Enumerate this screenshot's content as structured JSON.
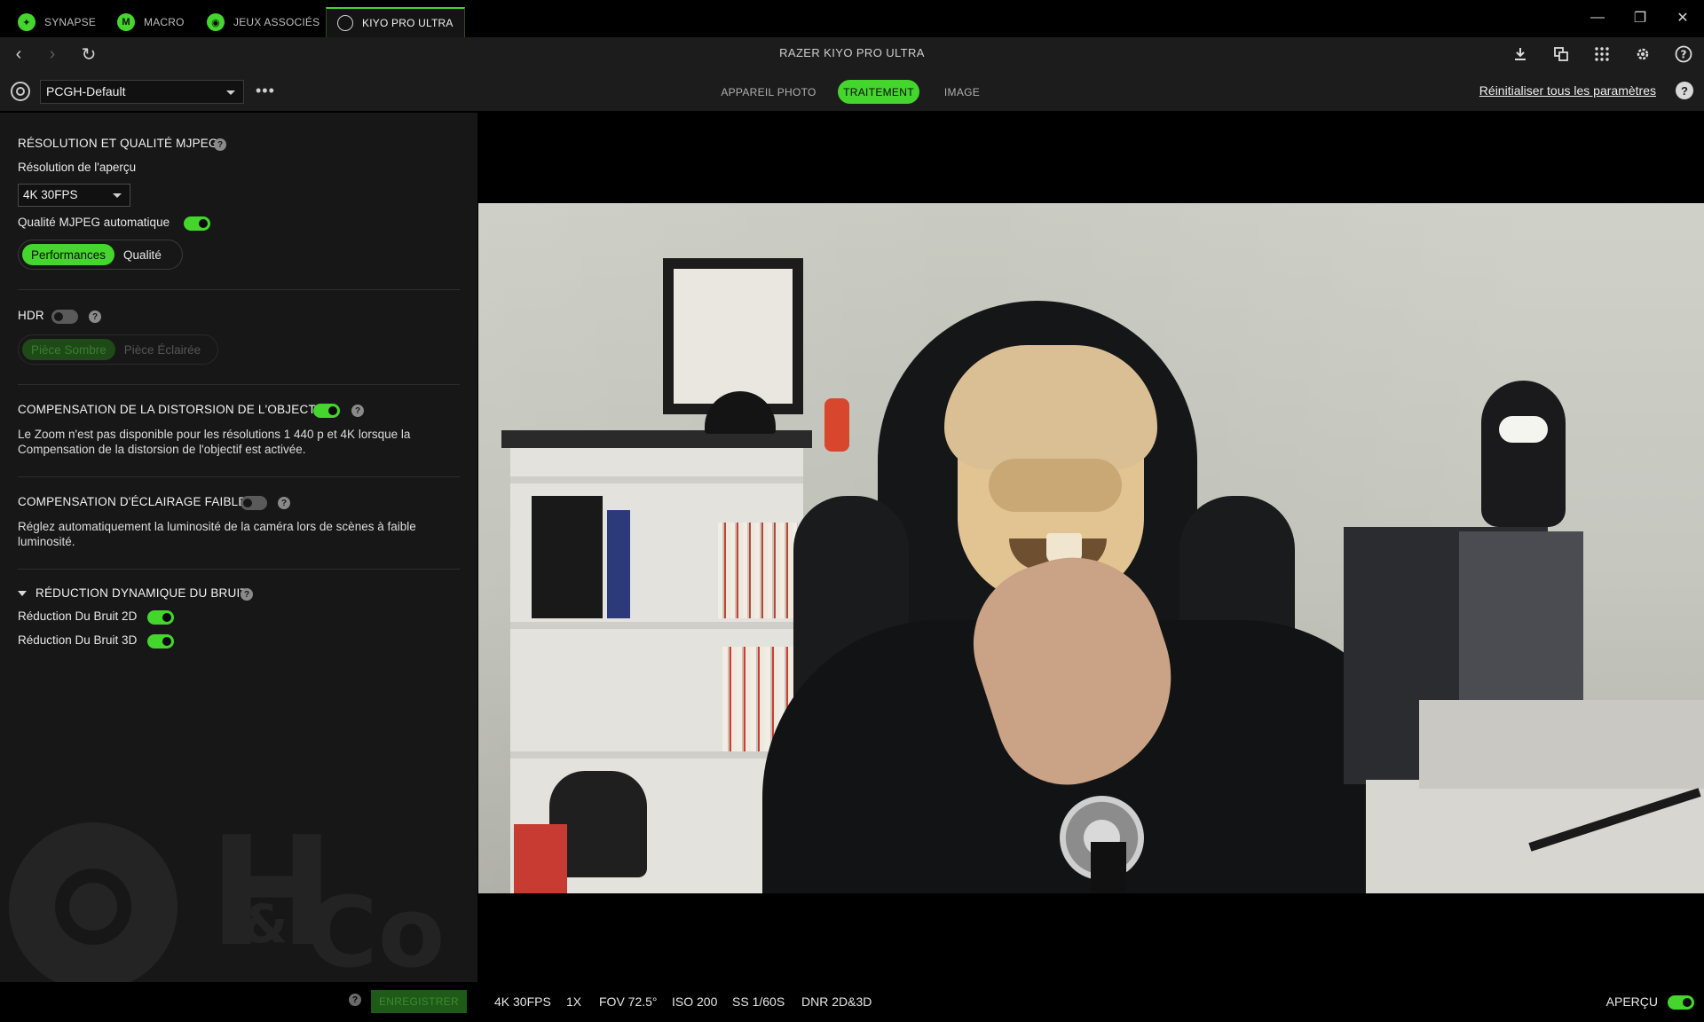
{
  "app_tabs": [
    {
      "label": "SYNAPSE",
      "icon": "razer-snake-icon"
    },
    {
      "label": "MACRO",
      "icon": "macro-m-icon"
    },
    {
      "label": "JEUX ASSOCIÉS",
      "icon": "gamepad-icon"
    },
    {
      "label": "KIYO PRO ULTRA",
      "icon": "webcam-icon"
    }
  ],
  "window_controls": {
    "minimize": "—",
    "restore": "❐",
    "close": "✕"
  },
  "nav": {
    "back": "‹",
    "forward": "›",
    "refresh": "↻",
    "title": "RAZER KIYO PRO ULTRA"
  },
  "toolbar_icons": [
    "download-icon",
    "overlay-icon",
    "apps-grid-icon",
    "gear-icon",
    "help-icon"
  ],
  "profile": {
    "name": "PCGH-Default",
    "more": "•••"
  },
  "view_tabs": [
    {
      "label": "APPAREIL PHOTO",
      "active": false
    },
    {
      "label": "TRAITEMENT",
      "active": true
    },
    {
      "label": "IMAGE",
      "active": false
    }
  ],
  "reset_label": "Réinitialiser tous les paramètres",
  "help_glyph": "?",
  "resolution_section": {
    "title": "RÉSOLUTION ET QUALITÉ MJPEG",
    "preview_label": "Résolution de l'aperçu",
    "preview_value": "4K 30FPS",
    "auto_quality_label": "Qualité MJPEG automatique",
    "auto_quality_on": true,
    "modes": [
      "Performances",
      "Qualité"
    ],
    "active_mode": "Performances"
  },
  "hdr_section": {
    "title": "HDR",
    "enabled": false,
    "modes": [
      "Pièce Sombre",
      "Pièce Éclairée"
    ],
    "active_mode": "Pièce Sombre"
  },
  "distortion_section": {
    "title": "COMPENSATION DE LA DISTORSION DE L'OBJECTIF",
    "enabled": true,
    "description": "Le Zoom n'est pas disponible pour les résolutions 1 440 p et 4K lorsque la Compensation de la distorsion de l'objectif est activée."
  },
  "lowlight_section": {
    "title": "COMPENSATION D'ÉCLAIRAGE FAIBLE",
    "enabled": false,
    "description": "Réglez automatiquement la luminosité de la caméra lors de scènes à faible luminosité."
  },
  "noise_section": {
    "title": "RÉDUCTION DYNAMIQUE DU BRUIT",
    "items": [
      {
        "label": "Réduction Du Bruit 2D",
        "enabled": true
      },
      {
        "label": "Réduction Du Bruit 3D",
        "enabled": true
      }
    ]
  },
  "watermark": {
    "letters": [
      "H",
      "&",
      "Co"
    ]
  },
  "status": {
    "save_label": "ENREGISTRER",
    "stats": [
      "4K 30FPS",
      "1X",
      "FOV 72.5°",
      "ISO 200",
      "SS 1/60S",
      "DNR 2D&3D"
    ],
    "apercu_label": "APERÇU",
    "apercu_on": true
  },
  "colors": {
    "accent": "#44d62c",
    "panel": "#171717",
    "bar": "#1c1c1c"
  }
}
